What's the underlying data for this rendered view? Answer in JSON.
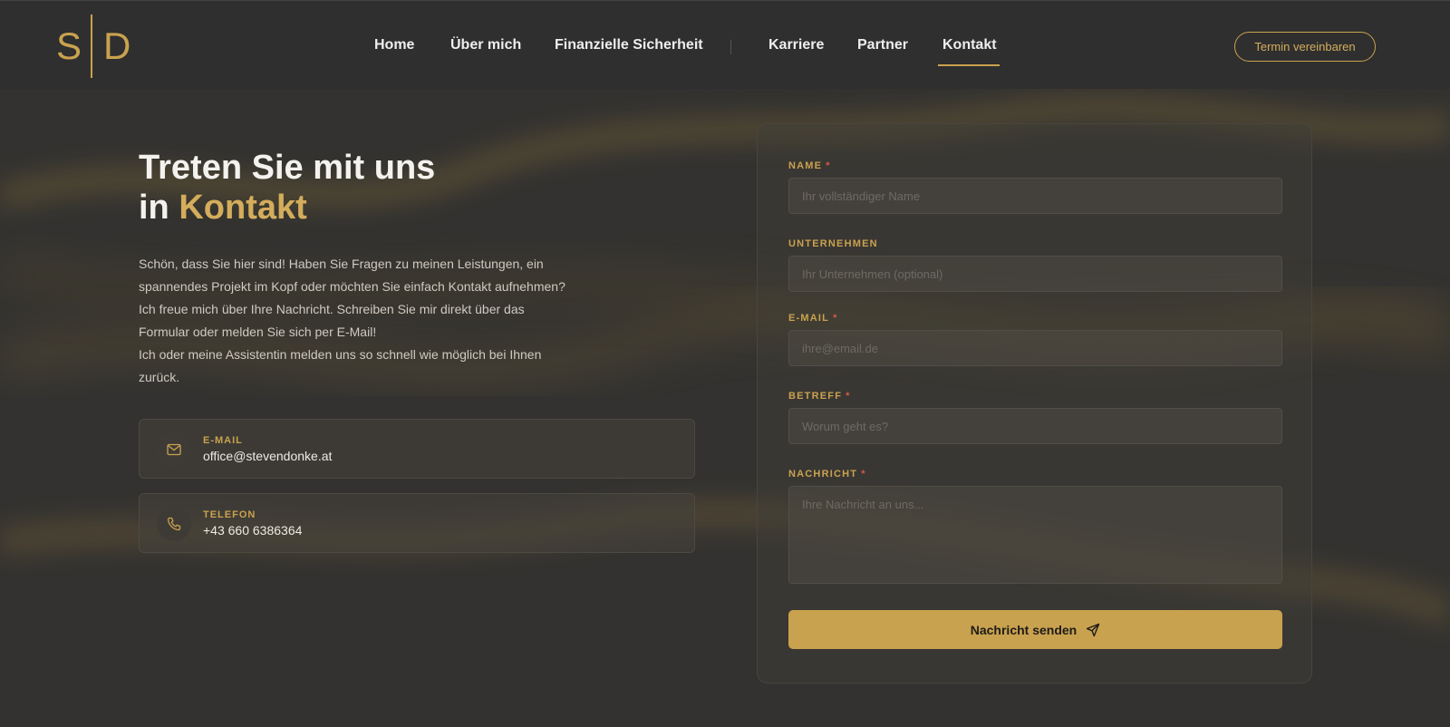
{
  "logo": {
    "left": "S",
    "right": "D"
  },
  "nav": {
    "items": [
      "Home",
      "Über mich",
      "Finanzielle Sicherheit",
      "Karriere",
      "Partner",
      "Kontakt"
    ],
    "active": "Kontakt",
    "cta_label": "Termin vereinbaren"
  },
  "hero": {
    "title_line1": "Treten Sie mit uns",
    "title_line2_prefix": "in",
    "title_line2_accent": "Kontakt",
    "intro_paragraph1": "Schön, dass Sie hier sind! Haben Sie Fragen zu meinen Leistungen, ein spannendes Projekt im Kopf oder möchten Sie einfach Kontakt aufnehmen? Ich freue mich über Ihre Nachricht. Schreiben Sie mir direkt über das Formular oder melden Sie sich per E-Mail!",
    "intro_paragraph2": "Ich oder meine Assistentin melden uns so schnell wie möglich bei Ihnen zurück."
  },
  "contact": {
    "email": {
      "label": "E-MAIL",
      "value": "office@stevendonke.at",
      "icon": "mail-icon"
    },
    "phone": {
      "label": "TELEFON",
      "value": "+43 660 6386364",
      "icon": "phone-icon"
    }
  },
  "form": {
    "name": {
      "label": "NAME",
      "required": "*",
      "placeholder": "Ihr vollständiger Name"
    },
    "company": {
      "label": "UNTERNEHMEN",
      "placeholder": "Ihr Unternehmen (optional)"
    },
    "email": {
      "label": "E-MAIL",
      "required": "*",
      "placeholder": "ihre@email.de"
    },
    "subject": {
      "label": "BETREFF",
      "required": "*",
      "placeholder": "Worum geht es?"
    },
    "message": {
      "label": "NACHRICHT",
      "required": "*",
      "placeholder": "Ihre Nachricht an uns..."
    },
    "submit_label": "Nachricht senden"
  },
  "colors": {
    "accent": "#c9a24f",
    "background": "#303030",
    "required": "#d8574a"
  }
}
